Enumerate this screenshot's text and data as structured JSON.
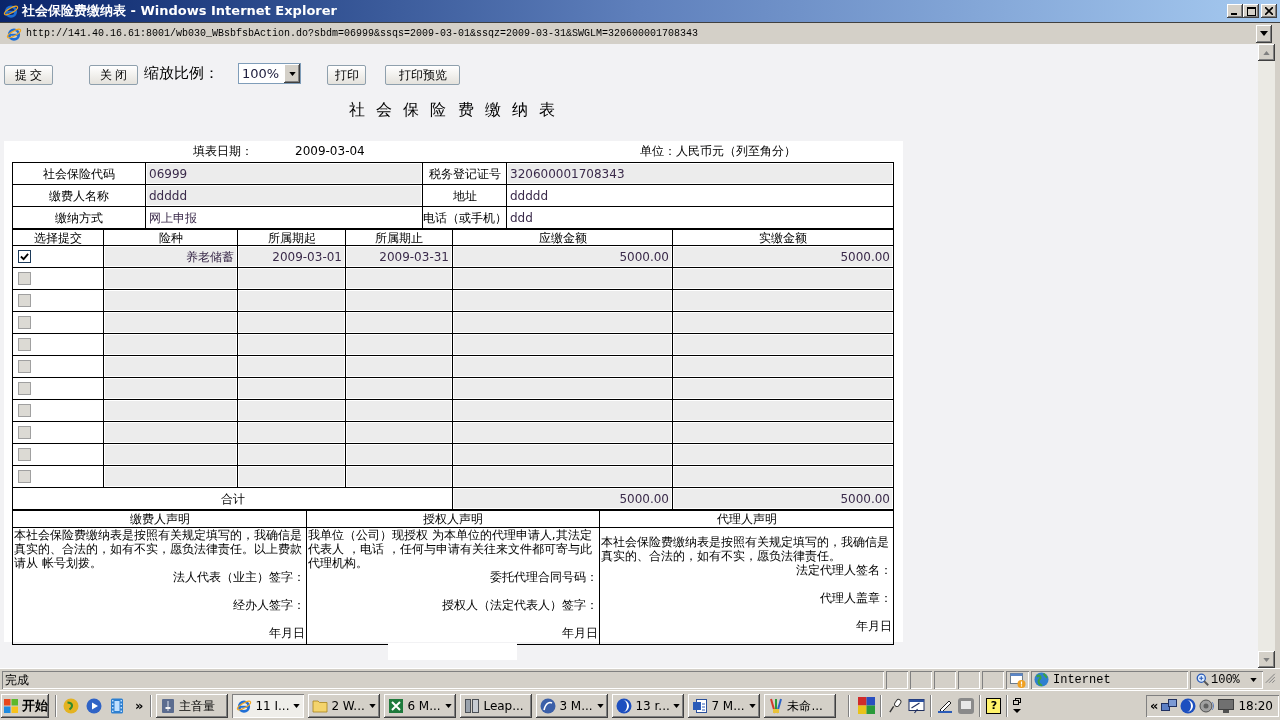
{
  "window": {
    "title": "社会保险费缴纳表 - Windows Internet Explorer"
  },
  "address_bar": {
    "url": "http://141.40.16.61:8001/wb030_WBsbfsbAction.do?sbdm=06999&ssqs=2009-03-01&ssqz=2009-03-31&SWGLM=320600001708343"
  },
  "toolbar": [
    {
      "kind": "button",
      "label": "提 交"
    },
    {
      "kind": "button",
      "label": "关 闭"
    },
    {
      "kind": "label",
      "label": "缩放比例："
    },
    {
      "kind": "select",
      "value": "100%"
    },
    {
      "kind": "button",
      "label": "打印"
    },
    {
      "kind": "button",
      "label": "打印预览"
    }
  ],
  "form": {
    "title": "社 会 保 险 费 缴 纳 表",
    "date_label": "填表日期：",
    "date": "2009-03-04",
    "unit": "单位：人民币元（列至角分）",
    "info": [
      {
        "label": "社会保险代码",
        "value": "06999",
        "readonly": true
      },
      {
        "label": "税务登记证号",
        "value": "320600001708343",
        "readonly": true
      },
      {
        "label": "缴费人名称",
        "value": "ddddd",
        "readonly": true
      },
      {
        "label": "地址",
        "value": "ddddd",
        "readonly": false
      },
      {
        "label": "缴纳方式",
        "value": "网上申报",
        "readonly": false
      },
      {
        "label": "电话（或手机）",
        "value": "ddd",
        "readonly": false
      }
    ],
    "columns": [
      "选择提交",
      "险种",
      "所属期起",
      "所属期止",
      "应缴金额",
      "实缴金额"
    ],
    "rows": [
      {
        "checked": true,
        "disabled": false,
        "cells": [
          "养老储蓄",
          "2009-03-01",
          "2009-03-31",
          "5000.00",
          "5000.00"
        ]
      },
      {
        "checked": false,
        "disabled": true
      },
      {
        "checked": false,
        "disabled": true
      },
      {
        "checked": false,
        "disabled": true
      },
      {
        "checked": false,
        "disabled": true
      },
      {
        "checked": false,
        "disabled": true
      },
      {
        "checked": false,
        "disabled": true
      },
      {
        "checked": false,
        "disabled": true
      },
      {
        "checked": false,
        "disabled": true
      },
      {
        "checked": false,
        "disabled": true
      },
      {
        "checked": false,
        "disabled": true
      }
    ],
    "total": {
      "label": "合计",
      "values": [
        "5000.00",
        "5000.00"
      ]
    },
    "declarations": [
      {
        "title": "缴费人声明",
        "text": "本社会保险费缴纳表是按照有关规定填写的，我确信是真实的、合法的，如有不实，愿负法律责任。以上费款请从 帐号划拨。",
        "signatures": [
          "法人代表（业主）签字：",
          "经办人签字：",
          "年月日"
        ]
      },
      {
        "title": "授权人声明",
        "text": "我单位（公司）现授权 为本单位的代理申请人,其法定代表人 ，电话 ，任何与申请有关往来文件都可寄与此代理机构。",
        "signatures": [
          "委托代理合同号码：",
          "授权人（法定代表人）签字：",
          "年月日"
        ]
      },
      {
        "title": "代理人声明",
        "text": "本社会保险费缴纳表是按照有关规定填写的，我确信是真实的、合法的，如有不实，愿负法律责任。",
        "signatures": [
          "法定代理人签名：",
          "代理人盖章：",
          "年月日"
        ]
      }
    ]
  },
  "status_bar": {
    "text": "完成",
    "zone": "Internet",
    "zoom": "100%"
  },
  "taskbar": {
    "start": "开始",
    "more": "»",
    "tasks": [
      {
        "label": "主音量",
        "grouped": false,
        "selected": false
      },
      {
        "label": "11 I...",
        "grouped": true,
        "selected": true
      },
      {
        "label": "2 W...",
        "grouped": true,
        "selected": false
      },
      {
        "label": "6 M...",
        "grouped": true,
        "selected": false
      },
      {
        "label": "Leap...",
        "grouped": false,
        "selected": false
      },
      {
        "label": "3 M...",
        "grouped": true,
        "selected": false
      },
      {
        "label": "13 r...",
        "grouped": true,
        "selected": false
      },
      {
        "label": "7 M...",
        "grouped": true,
        "selected": false
      },
      {
        "label": "未命...",
        "grouped": false,
        "selected": false
      }
    ],
    "help": "?",
    "tray_expand": "«",
    "clock": "18:20"
  }
}
